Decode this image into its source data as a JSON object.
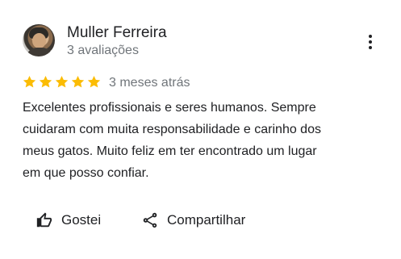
{
  "review": {
    "author": "Muller Ferreira",
    "author_meta": "3 avaliações",
    "rating": 5,
    "rating_max": 5,
    "date": "3 meses atrás",
    "text": "Excelentes profissionais e seres humanos. Sempre\ncuidaram com muita responsabilidade e carinho dos\nmeus gatos. Muito feliz em ter encontrado um lugar\nem que posso confiar."
  },
  "actions": {
    "like_label": "Gostei",
    "share_label": "Compartilhar"
  },
  "icons": {
    "menu": "more-vert-icon",
    "like": "thumb-up-icon",
    "share": "share-icon",
    "star": "star-icon"
  },
  "colors": {
    "star": "#fbbc04",
    "text": "#202124",
    "secondary": "#70757a"
  }
}
